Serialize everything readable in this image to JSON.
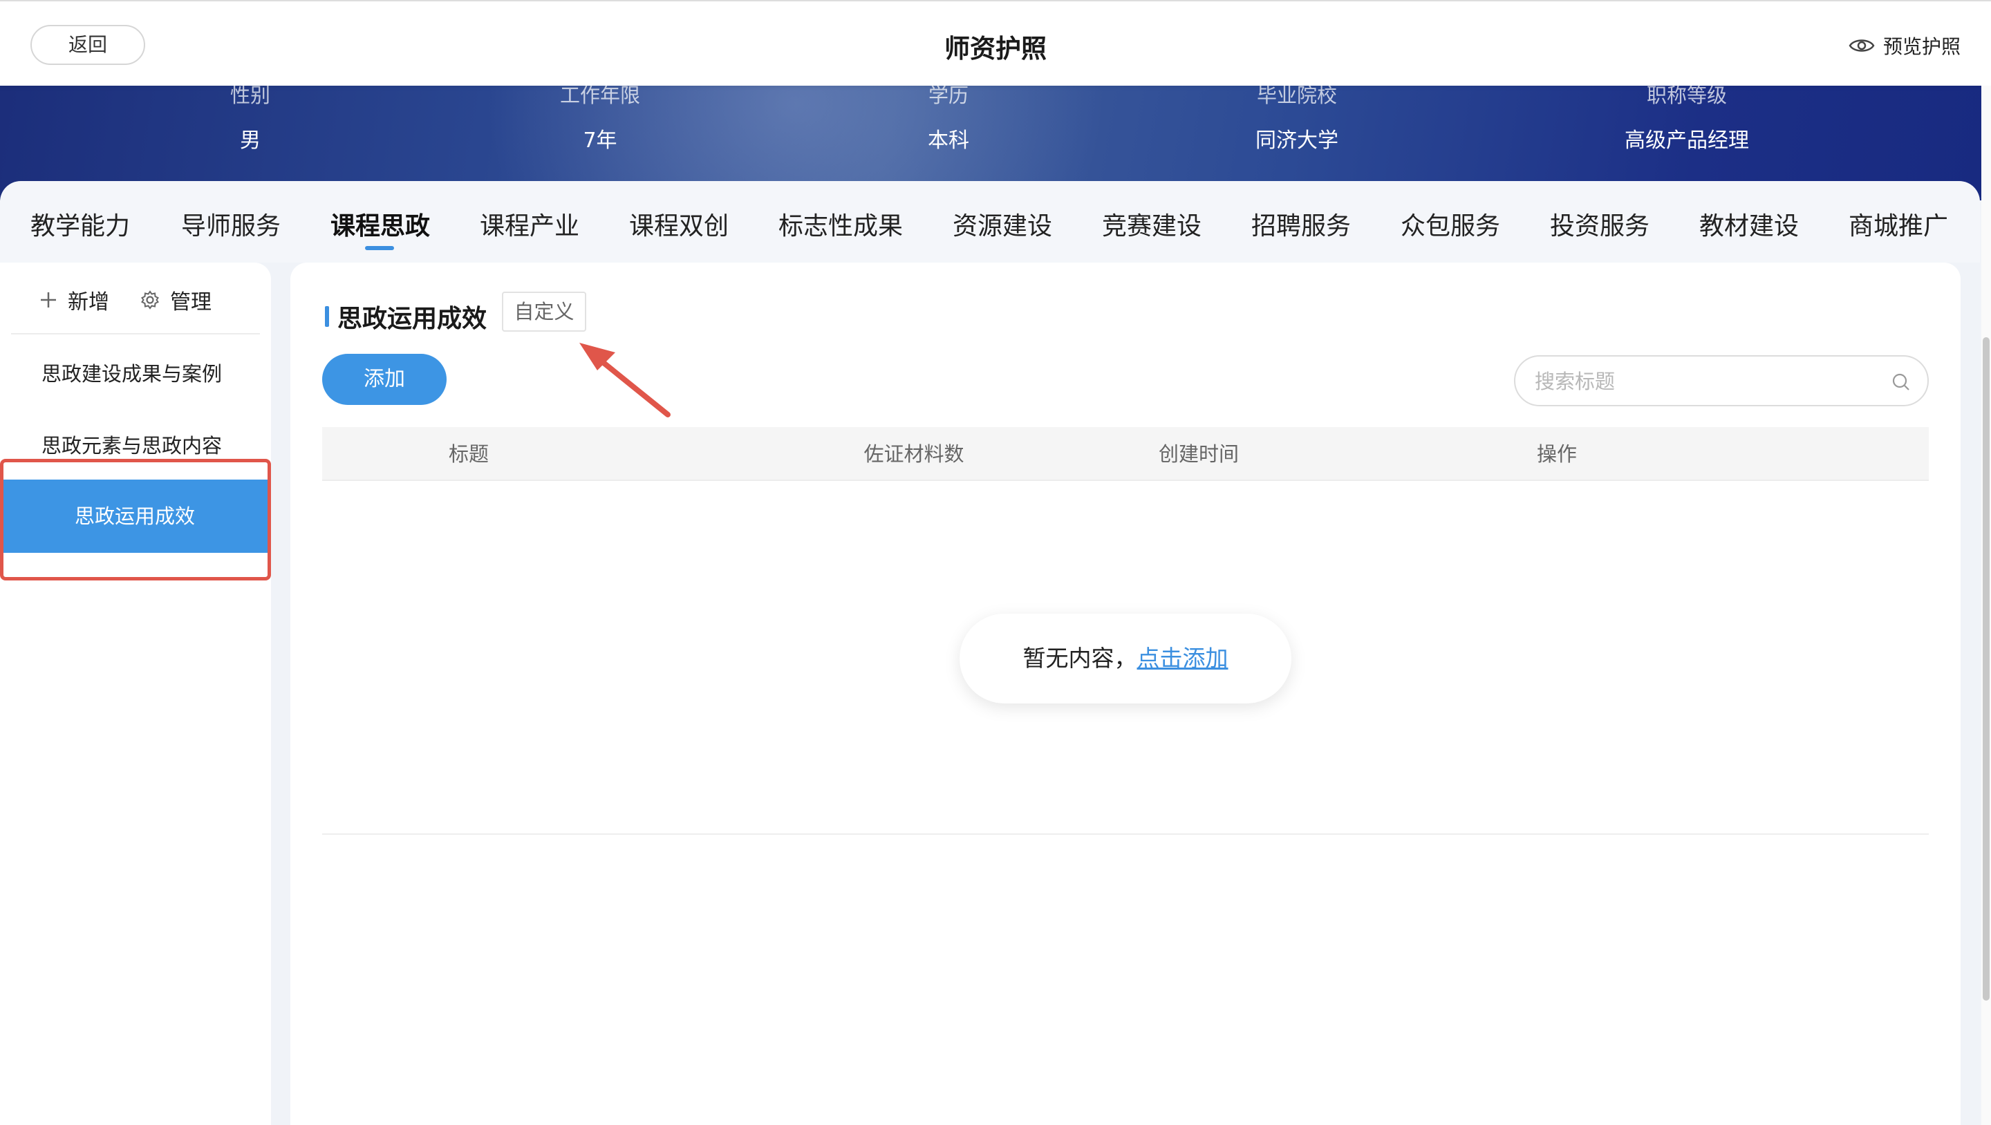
{
  "header": {
    "back_label": "返回",
    "title": "师资护照",
    "preview_label": "预览护照"
  },
  "profile": {
    "fields": [
      {
        "label": "性别",
        "value": "男"
      },
      {
        "label": "工作年限",
        "value": "7年"
      },
      {
        "label": "学历",
        "value": "本科"
      },
      {
        "label": "毕业院校",
        "value": "同济大学"
      },
      {
        "label": "职称等级",
        "value": "高级产品经理"
      }
    ]
  },
  "tabs": [
    {
      "label": "教学能力"
    },
    {
      "label": "导师服务"
    },
    {
      "label": "课程思政",
      "active": true
    },
    {
      "label": "课程产业"
    },
    {
      "label": "课程双创"
    },
    {
      "label": "标志性成果"
    },
    {
      "label": "资源建设"
    },
    {
      "label": "竞赛建设"
    },
    {
      "label": "招聘服务"
    },
    {
      "label": "众包服务"
    },
    {
      "label": "投资服务"
    },
    {
      "label": "教材建设"
    },
    {
      "label": "商城推广"
    }
  ],
  "sidebar": {
    "add_label": "新增",
    "manage_label": "管理",
    "items": [
      {
        "label": "思政建设成果与案例"
      },
      {
        "label": "思政元素与思政内容"
      },
      {
        "label": "思政运用成效",
        "active": true
      }
    ]
  },
  "main": {
    "section_title": "思政运用成效",
    "custom_label": "自定义",
    "add_button": "添加",
    "search_placeholder": "搜索标题",
    "columns": [
      "标题",
      "佐证材料数",
      "创建时间",
      "操作"
    ],
    "empty_text": "暂无内容，",
    "empty_link": "点击添加"
  },
  "colors": {
    "accent": "#3d95e4",
    "highlight_outline": "#e0564a",
    "banner_dark": "#1b2d7a"
  },
  "icons": {
    "preview": "eye-icon",
    "add": "plus-icon",
    "manage": "gear-icon",
    "search": "search-icon",
    "annotation": "red-arrow-icon"
  }
}
